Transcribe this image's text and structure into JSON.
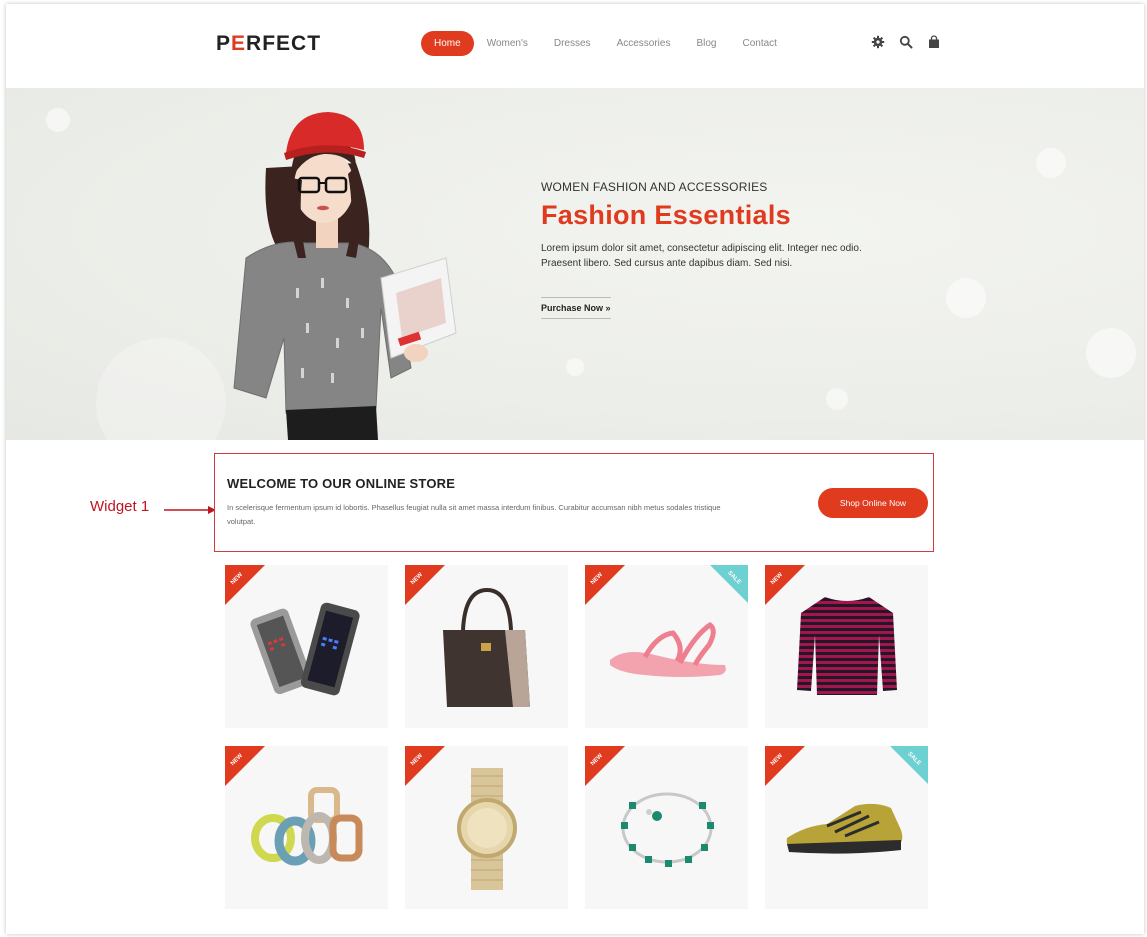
{
  "brand": {
    "logo_prefix": "P",
    "logo_e": "E",
    "logo_rest": "RFECT",
    "accent": "#e03a1f"
  },
  "nav": {
    "items": [
      {
        "label": "Home",
        "active": true
      },
      {
        "label": "Women's"
      },
      {
        "label": "Dresses"
      },
      {
        "label": "Accessories"
      },
      {
        "label": "Blog"
      },
      {
        "label": "Contact"
      }
    ]
  },
  "header_icons": [
    "gear-icon",
    "search-icon",
    "shopping-bag-icon"
  ],
  "hero": {
    "subtitle": "WOMEN FASHION AND ACCESSORIES",
    "title": "Fashion Essentials",
    "description": "Lorem ipsum dolor sit amet, consectetur adipiscing elit. Integer nec odio. Praesent libero. Sed cursus ante dapibus diam. Sed nisi.",
    "cta": "Purchase Now  »"
  },
  "annotation": {
    "label": "Widget 1"
  },
  "widget": {
    "title": "WELCOME TO OUR ONLINE STORE",
    "text": "In scelerisque fermentum ipsum id lobortis. Phasellus feugiat nulla sit amet massa interdum finibus. Curabitur accumsan nibh metus sodales tristique volutpat.",
    "button": "Shop Online Now"
  },
  "products": [
    {
      "name": "led-watches",
      "badge_new": "NEW",
      "badge_sale": ""
    },
    {
      "name": "handbag",
      "badge_new": "NEW",
      "badge_sale": ""
    },
    {
      "name": "sandal",
      "badge_new": "NEW",
      "badge_sale": "SALE"
    },
    {
      "name": "striped-sweater",
      "badge_new": "NEW",
      "badge_sale": ""
    },
    {
      "name": "bangles",
      "badge_new": "NEW",
      "badge_sale": ""
    },
    {
      "name": "gold-watch",
      "badge_new": "NEW",
      "badge_sale": ""
    },
    {
      "name": "necklace",
      "badge_new": "NEW",
      "badge_sale": ""
    },
    {
      "name": "sneaker",
      "badge_new": "NEW",
      "badge_sale": "SALE"
    }
  ]
}
